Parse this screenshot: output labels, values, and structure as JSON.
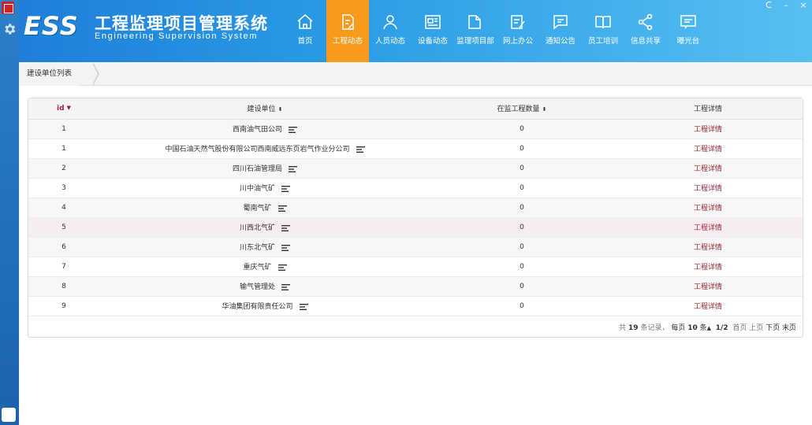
{
  "app": {
    "brand_abbr": "ESS",
    "title_cn": "工程监理项目管理系统",
    "title_en": "Engineering Supervision System"
  },
  "nav": [
    {
      "label": "首页",
      "icon": "home-icon",
      "active": false
    },
    {
      "label": "工程动态",
      "icon": "edit-doc-icon",
      "active": true
    },
    {
      "label": "人员动态",
      "icon": "user-icon",
      "active": false
    },
    {
      "label": "设备动态",
      "icon": "news-icon",
      "active": false
    },
    {
      "label": "监理项目部",
      "icon": "folder-icon",
      "active": false
    },
    {
      "label": "网上办公",
      "icon": "pen-doc-icon",
      "active": false
    },
    {
      "label": "通知公告",
      "icon": "chat-icon",
      "active": false
    },
    {
      "label": "员工培训",
      "icon": "book-icon",
      "active": false
    },
    {
      "label": "信息共享",
      "icon": "share-icon",
      "active": false
    },
    {
      "label": "曝光台",
      "icon": "message-icon",
      "active": false
    }
  ],
  "window_controls": {
    "refresh": "C",
    "minimize": "–",
    "close": "×"
  },
  "breadcrumb": "建设单位列表",
  "table": {
    "headers": {
      "id": "id",
      "unit": "建设单位",
      "count": "在监工程数量",
      "detail": "工程详情"
    },
    "rows": [
      {
        "id": "1",
        "unit": "西南油气田公司",
        "count": "0",
        "detail": "工程详情"
      },
      {
        "id": "1",
        "unit": "中国石油天然气股份有限公司西南威远东页岩气作业分公司",
        "count": "0",
        "detail": "工程详情"
      },
      {
        "id": "2",
        "unit": "四川石油管理局",
        "count": "0",
        "detail": "工程详情"
      },
      {
        "id": "3",
        "unit": "川中油气矿",
        "count": "0",
        "detail": "工程详情"
      },
      {
        "id": "4",
        "unit": "蜀南气矿",
        "count": "0",
        "detail": "工程详情"
      },
      {
        "id": "5",
        "unit": "川西北气矿",
        "count": "0",
        "detail": "工程详情"
      },
      {
        "id": "6",
        "unit": "川东北气矿",
        "count": "0",
        "detail": "工程详情"
      },
      {
        "id": "7",
        "unit": "重庆气矿",
        "count": "0",
        "detail": "工程详情"
      },
      {
        "id": "8",
        "unit": "输气管理处",
        "count": "0",
        "detail": "工程详情"
      },
      {
        "id": "9",
        "unit": "华油集团有限责任公司",
        "count": "0",
        "detail": "工程详情"
      }
    ]
  },
  "pagination": {
    "total_prefix": "共",
    "total": "19",
    "total_suffix": "条记录，",
    "per_page_prefix": "每页",
    "per_page": "10",
    "per_page_suffix": "条",
    "page": "1/2",
    "first": "首页",
    "prev": "上页",
    "next": "下页",
    "last": "末页"
  },
  "colors": {
    "header_blue": "#1e7fd8",
    "active_orange": "#f89a1c",
    "accent_red": "#9b2335"
  }
}
